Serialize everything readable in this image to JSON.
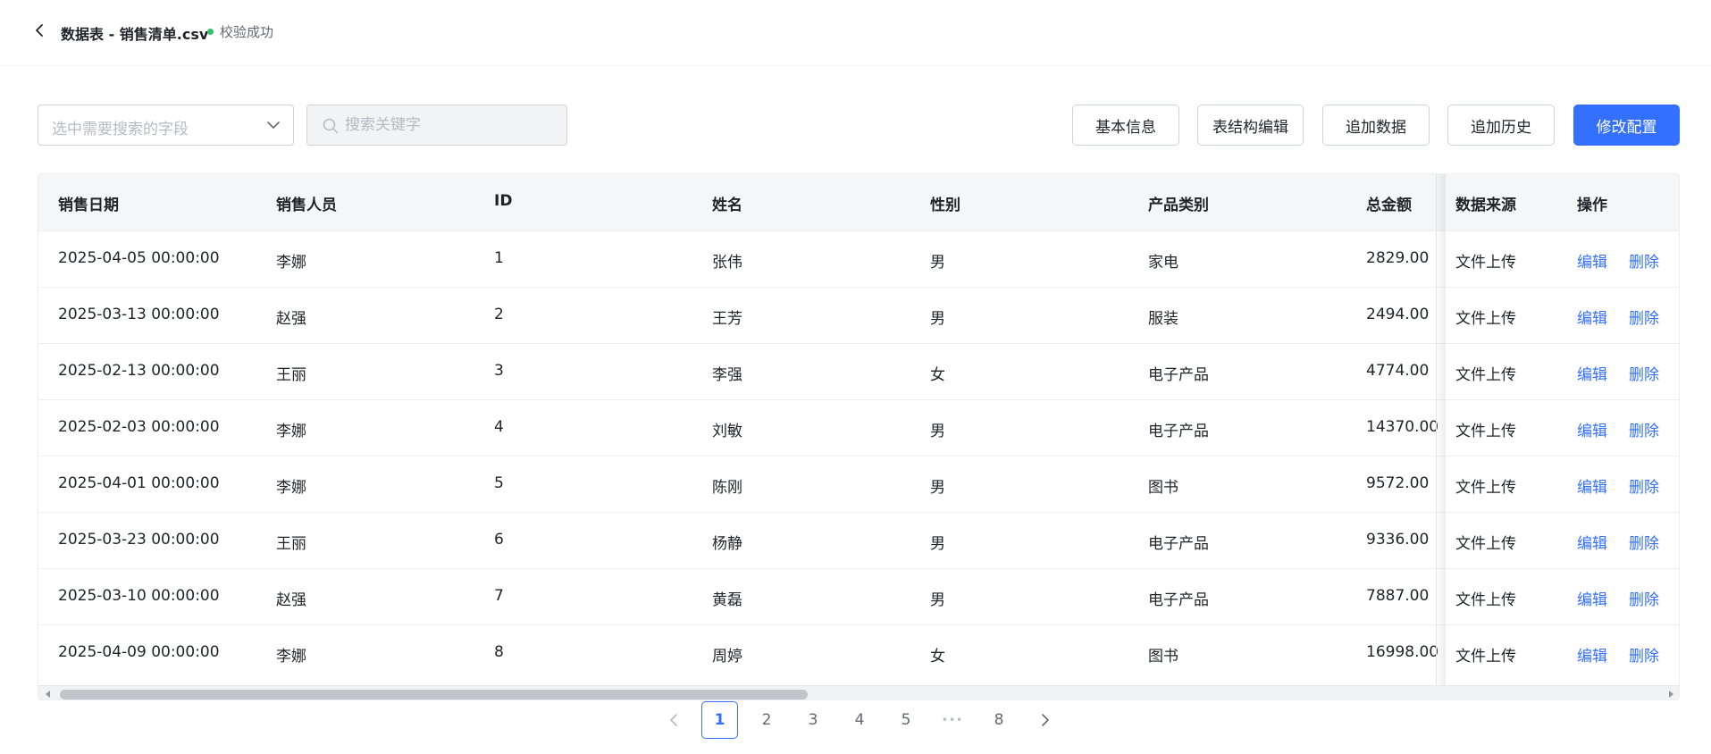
{
  "header": {
    "title": "数据表 - 销售清单.csv",
    "status": "校验成功",
    "status_color": "#2fc46a"
  },
  "toolbar": {
    "field_select_placeholder": "选中需要搜索的字段",
    "search_placeholder": "搜索关键字",
    "buttons": [
      "基本信息",
      "表结构编辑",
      "追加数据",
      "追加历史",
      "修改配置"
    ],
    "primary_color": "#3370ff"
  },
  "table": {
    "columns": [
      "销售日期",
      "销售人员",
      "ID",
      "姓名",
      "性别",
      "产品类别",
      "总金额",
      "数据来源",
      "操作"
    ],
    "rows": [
      [
        "2025-04-05 00:00:00",
        "李娜",
        "1",
        "张伟",
        "男",
        "家电",
        "2829.00",
        "文件上传"
      ],
      [
        "2025-03-13 00:00:00",
        "赵强",
        "2",
        "王芳",
        "男",
        "服装",
        "2494.00",
        "文件上传"
      ],
      [
        "2025-02-13 00:00:00",
        "王丽",
        "3",
        "李强",
        "女",
        "电子产品",
        "4774.00",
        "文件上传"
      ],
      [
        "2025-02-03 00:00:00",
        "李娜",
        "4",
        "刘敏",
        "男",
        "电子产品",
        "14370.00",
        "文件上传"
      ],
      [
        "2025-04-01 00:00:00",
        "李娜",
        "5",
        "陈刚",
        "男",
        "图书",
        "9572.00",
        "文件上传"
      ],
      [
        "2025-03-23 00:00:00",
        "王丽",
        "6",
        "杨静",
        "男",
        "电子产品",
        "9336.00",
        "文件上传"
      ],
      [
        "2025-03-10 00:00:00",
        "赵强",
        "7",
        "黄磊",
        "男",
        "电子产品",
        "7887.00",
        "文件上传"
      ],
      [
        "2025-04-09 00:00:00",
        "李娜",
        "8",
        "周婷",
        "女",
        "图书",
        "16998.00",
        "文件上传"
      ]
    ],
    "actions": [
      "编辑",
      "删除"
    ]
  },
  "pagination": {
    "current": "1",
    "pages": [
      "1",
      "2",
      "3",
      "4",
      "5",
      "•••",
      "8"
    ]
  }
}
